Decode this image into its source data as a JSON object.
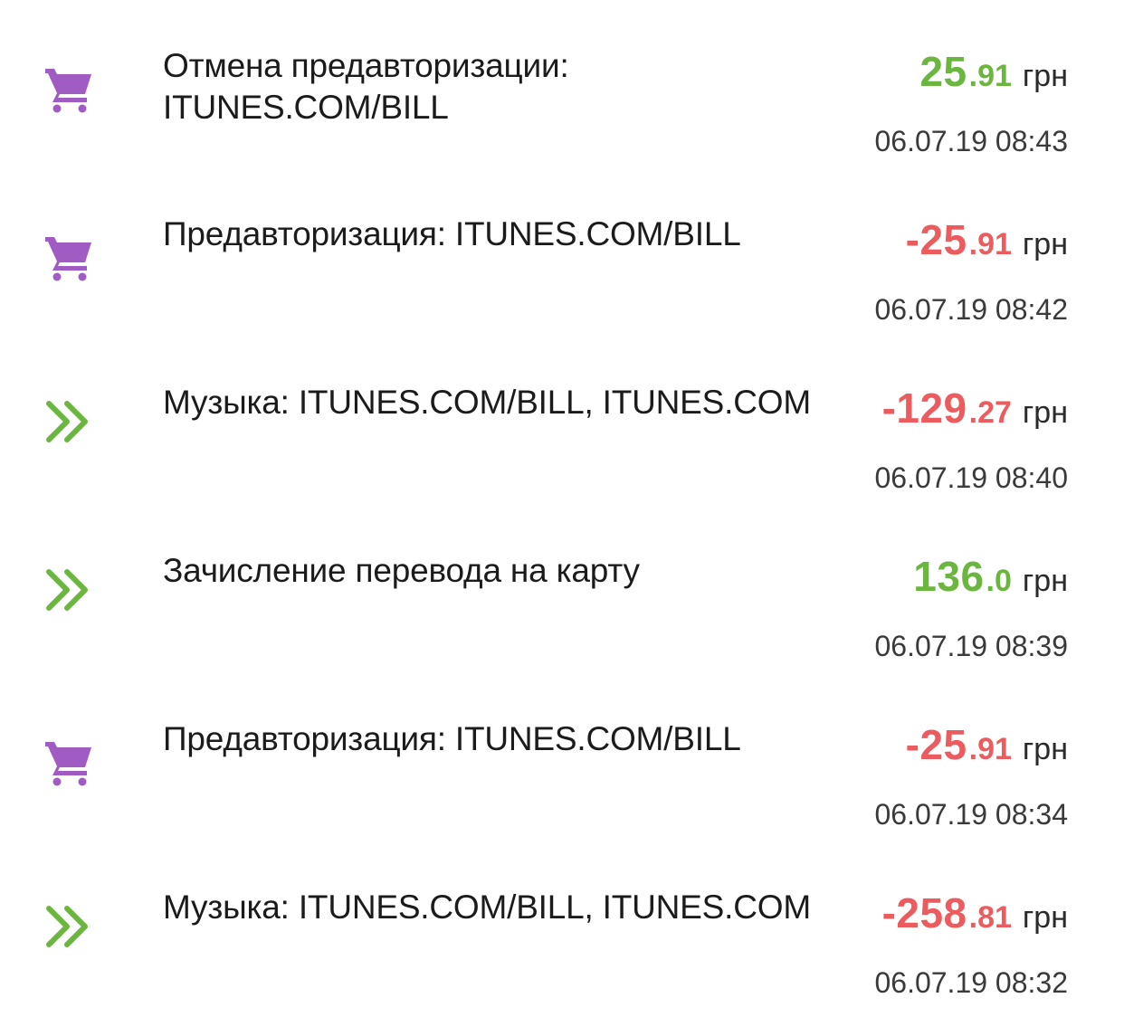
{
  "colors": {
    "positive": "#6ab63f",
    "negative": "#ec5b5e",
    "cart_icon": "#a15cc4",
    "transfer_icon": "#6ab63f"
  },
  "transactions": [
    {
      "icon": "shopping-cart-icon",
      "description": "Отмена предавторизации: ITUNES.COM/BILL",
      "sign": "",
      "amount_int": "25",
      "amount_dec": ".91",
      "currency": "грн",
      "type": "positive",
      "datetime": "06.07.19 08:43"
    },
    {
      "icon": "shopping-cart-icon",
      "description": "Предавторизация: ITUNES.COM/BILL",
      "sign": "-",
      "amount_int": "-25",
      "amount_dec": ".91",
      "currency": "грн",
      "type": "negative",
      "datetime": "06.07.19 08:42"
    },
    {
      "icon": "double-chevron-right-icon",
      "description": "Музыка: ITUNES.COM/BILL, ITUNES.COM",
      "sign": "-",
      "amount_int": "-129",
      "amount_dec": ".27",
      "currency": "грн",
      "type": "negative",
      "datetime": "06.07.19 08:40"
    },
    {
      "icon": "double-chevron-right-icon",
      "description": "Зачисление перевода на карту",
      "sign": "",
      "amount_int": "136",
      "amount_dec": ".0",
      "currency": "грн",
      "type": "positive",
      "datetime": "06.07.19 08:39"
    },
    {
      "icon": "shopping-cart-icon",
      "description": "Предавторизация: ITUNES.COM/BILL",
      "sign": "-",
      "amount_int": "-25",
      "amount_dec": ".91",
      "currency": "грн",
      "type": "negative",
      "datetime": "06.07.19 08:34"
    },
    {
      "icon": "double-chevron-right-icon",
      "description": "Музыка: ITUNES.COM/BILL, ITUNES.COM",
      "sign": "-",
      "amount_int": "-258",
      "amount_dec": ".81",
      "currency": "грн",
      "type": "negative",
      "datetime": "06.07.19 08:32"
    }
  ]
}
